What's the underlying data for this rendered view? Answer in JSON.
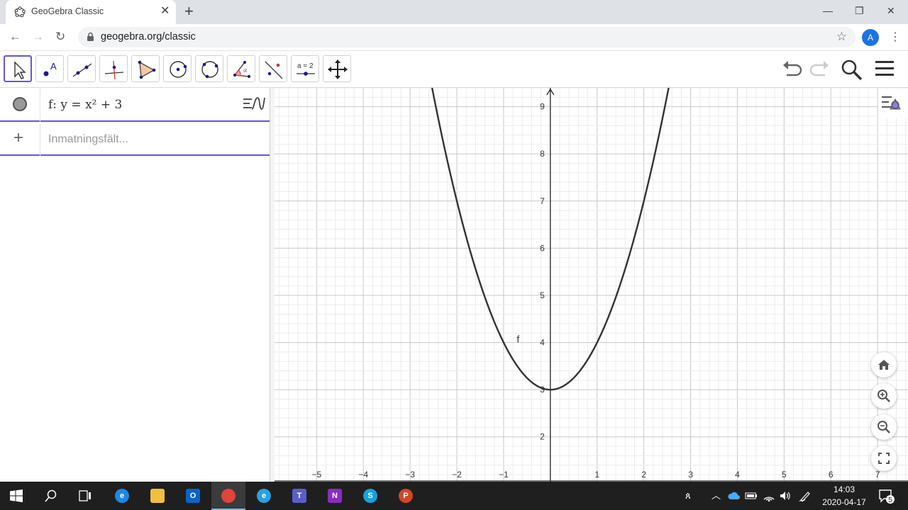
{
  "browser": {
    "tab_title": "GeoGebra Classic",
    "tab_close": "✕",
    "new_tab": "+",
    "url": "geogebra.org/classic",
    "profile_initial": "A"
  },
  "geogebra": {
    "tools": [
      {
        "name": "move-tool",
        "active": true
      },
      {
        "name": "point-tool"
      },
      {
        "name": "line-tool"
      },
      {
        "name": "perpendicular-line-tool"
      },
      {
        "name": "polygon-tool"
      },
      {
        "name": "circle-tool"
      },
      {
        "name": "conic-tool"
      },
      {
        "name": "angle-tool"
      },
      {
        "name": "reflect-tool"
      },
      {
        "name": "slider-tool",
        "label": "a = 2"
      },
      {
        "name": "move-graphics-view-tool"
      }
    ],
    "algebra": {
      "expression": "f: y = x² + 3",
      "input_placeholder": "Inmatningsfält..."
    },
    "graphics": {
      "function_label": "f",
      "x_ticks": [
        "−5",
        "−4",
        "−3",
        "−2",
        "−1",
        "1",
        "2",
        "3",
        "4",
        "5",
        "6",
        "7"
      ],
      "y_ticks": [
        "2",
        "3",
        "4",
        "5",
        "6",
        "7",
        "8",
        "9"
      ],
      "curve_color": "#333333",
      "axis_color": "#222222"
    }
  },
  "chart_data": {
    "type": "line",
    "title": "",
    "xlabel": "",
    "ylabel": "",
    "xlim": [
      -5.9,
      7.65
    ],
    "ylim": [
      1.05,
      9.4
    ],
    "grid": true,
    "series": [
      {
        "name": "f",
        "formula": "y = x² + 3",
        "x": [
          -2.5,
          -2,
          -1.5,
          -1,
          -0.5,
          0,
          0.5,
          1,
          1.5,
          2,
          2.5
        ],
        "y": [
          9.25,
          7,
          5.25,
          4,
          3.25,
          3,
          3.25,
          4,
          5.25,
          7,
          9.25
        ]
      }
    ]
  },
  "taskbar": {
    "time": "14:03",
    "date": "2020-04-17",
    "notifications": "5",
    "apps": [
      {
        "name": "edge-icon",
        "color": "#1e88e5",
        "letter": "e"
      },
      {
        "name": "file-explorer-icon",
        "color": "#f0c040",
        "letter": ""
      },
      {
        "name": "outlook-icon",
        "color": "#0a64c8",
        "letter": "O"
      },
      {
        "name": "chrome-icon",
        "color": "#e0443a",
        "letter": ""
      },
      {
        "name": "internet-explorer-icon",
        "color": "#2aa1e0",
        "letter": "e"
      },
      {
        "name": "teams-icon",
        "color": "#5a5fc8",
        "letter": "T"
      },
      {
        "name": "onenote-icon",
        "color": "#8a2cc0",
        "letter": "N"
      },
      {
        "name": "skype-icon",
        "color": "#1aa0e0",
        "letter": "S"
      },
      {
        "name": "powerpoint-icon",
        "color": "#d24726",
        "letter": "P"
      }
    ]
  }
}
